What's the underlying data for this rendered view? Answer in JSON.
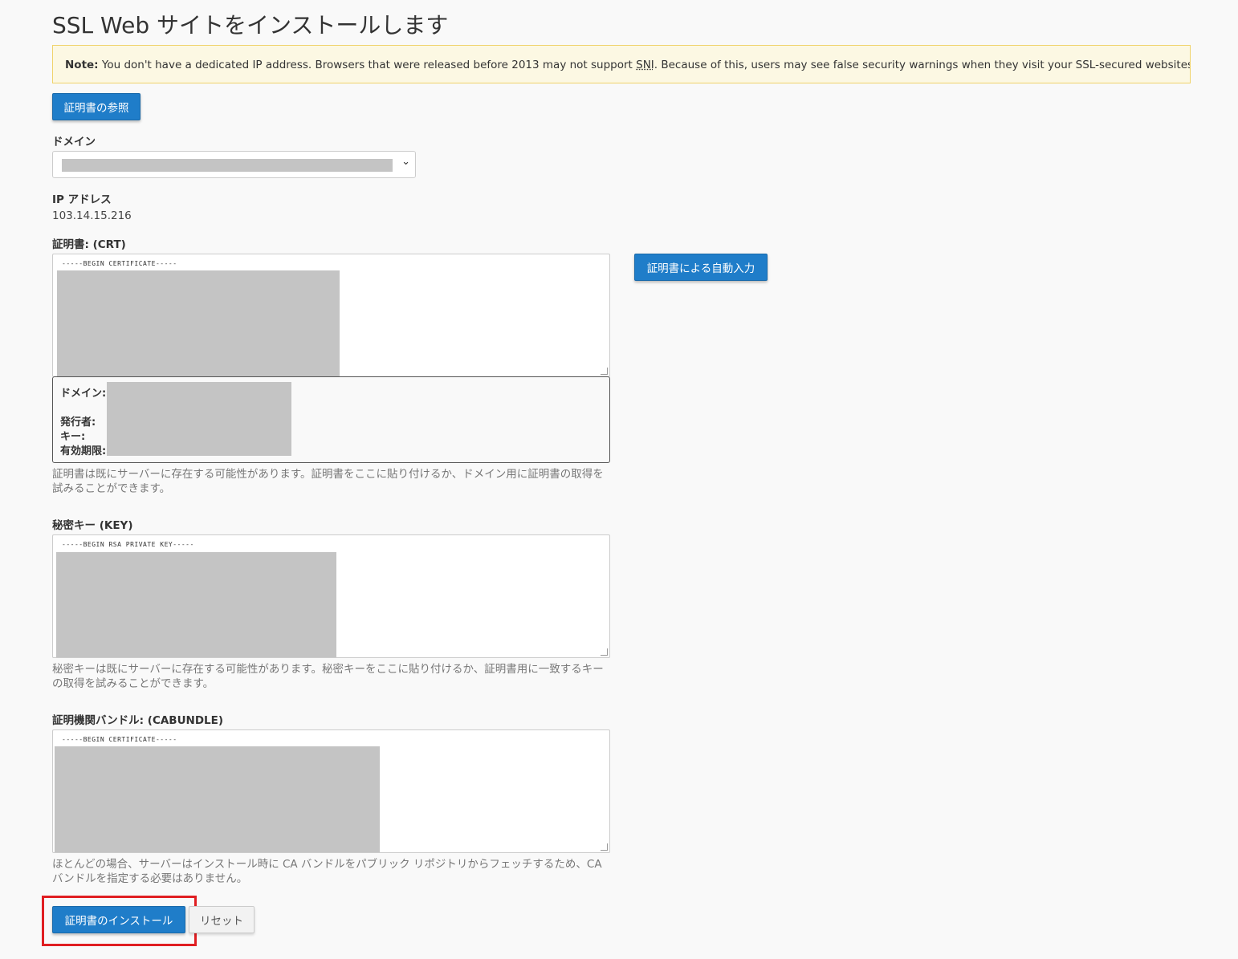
{
  "page": {
    "title": "SSL Web サイトをインストールします"
  },
  "note": {
    "prefix": "Note:",
    "text_before": " You don't have a dedicated IP address. Browsers that were released before 2013 may not support ",
    "abbr": "SNI",
    "text_after": ". Because of this, users may see false security warnings when they visit your SSL-secured websites.",
    "background_color": "#fcf8e3",
    "border_color": "#f0d36c"
  },
  "buttons": {
    "browse_certificates": "証明書の参照",
    "autofill_by_certificate": "証明書による自動入力",
    "install_certificate": "証明書のインストール",
    "reset": "リセット"
  },
  "domain": {
    "label": "ドメイン"
  },
  "ip": {
    "label": "IP アドレス",
    "value": "103.14.15.216"
  },
  "certificate": {
    "label": "証明書: (CRT)",
    "first_line": "-----BEGIN CERTIFICATE-----",
    "details": {
      "domain_label": "ドメイン:",
      "issuer_label": "発行者:",
      "key_label": "キー:",
      "expiry_label": "有効期限:"
    },
    "help": "証明書は既にサーバーに存在する可能性があります。証明書をここに貼り付けるか、ドメイン用に証明書の取得を試みることができます。"
  },
  "private_key": {
    "label": "秘密キー (KEY)",
    "first_line": "-----BEGIN RSA PRIVATE KEY-----",
    "help": "秘密キーは既にサーバーに存在する可能性があります。秘密キーをここに貼り付けるか、証明書用に一致するキーの取得を試みることができます。"
  },
  "ca_bundle": {
    "label": "証明機関バンドル: (CABUNDLE)",
    "first_line": "-----BEGIN CERTIFICATE-----",
    "help": "ほとんどの場合、サーバーはインストール時に CA バンドルをパブリック リポジトリからフェッチするため、CA バンドルを指定する必要はありません。"
  },
  "colors": {
    "primary_button": "#1f7dc9",
    "highlight_box": "#e01e22",
    "redaction": "#c4c4c4"
  }
}
